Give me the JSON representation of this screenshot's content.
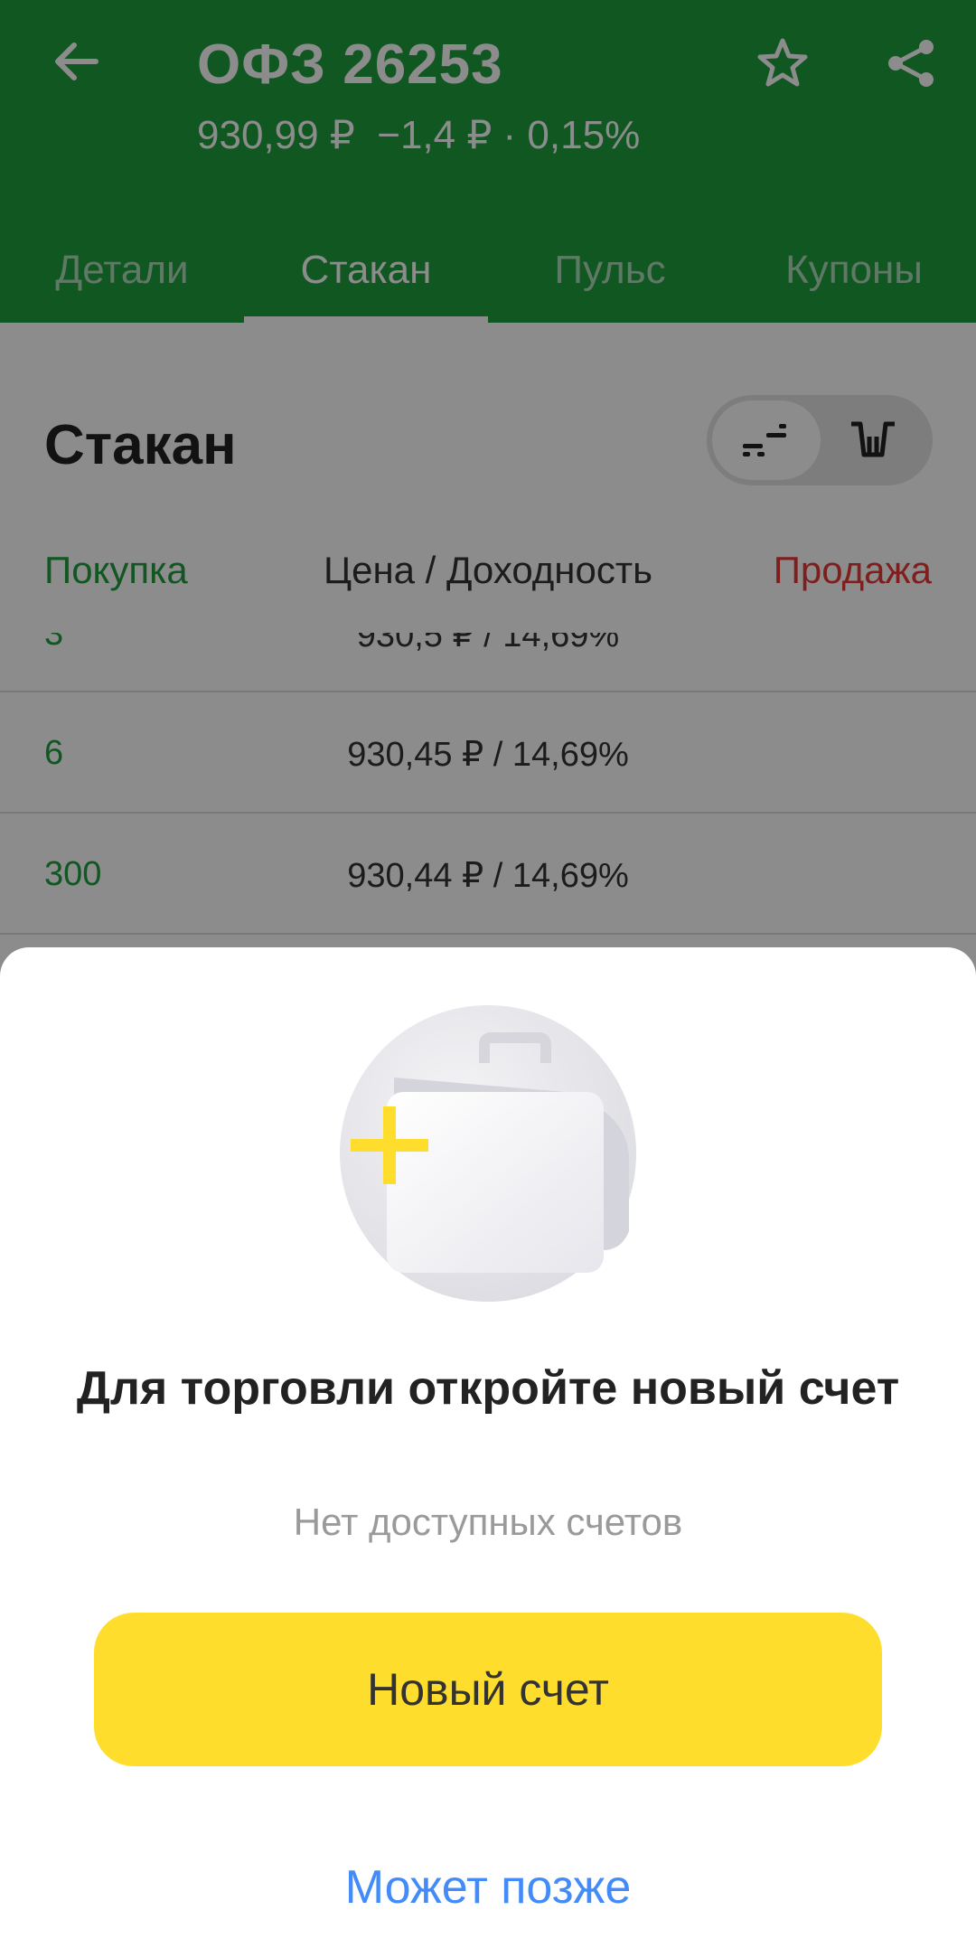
{
  "header": {
    "title": "ОФЗ 26253",
    "subtitle": "930,99 ₽  −1,4 ₽ · 0,15%",
    "icons": [
      "arrow-left-icon",
      "star-icon",
      "share-icon"
    ],
    "color": "#1f9e3e"
  },
  "tabs": [
    {
      "label": "Детали",
      "active": false
    },
    {
      "label": "Стакан",
      "active": true
    },
    {
      "label": "Пульс",
      "active": false
    },
    {
      "label": "Купоны",
      "active": false
    }
  ],
  "orderbook": {
    "title": "Стакан",
    "columns": {
      "buy": "Покупка",
      "price": "Цена / Доходность",
      "sell": "Продажа"
    },
    "rows": [
      {
        "qty": "3",
        "price": "930,5 ₽ / 14,69%"
      },
      {
        "qty": "6",
        "price": "930,45 ₽ / 14,69%"
      },
      {
        "qty": "300",
        "price": "930,44 ₽ / 14,69%"
      }
    ],
    "colors": {
      "buy": "#1f9e3e",
      "sell": "#e53935"
    }
  },
  "sheet": {
    "title": "Для торговли откройте новый счет",
    "subtitle": "Нет доступных счетов",
    "primary_button": "Новый счет",
    "secondary_button": "Может позже",
    "illustration": "briefcase-plus-icon",
    "colors": {
      "button": "#ffdd2d",
      "link": "#428bf9"
    }
  }
}
